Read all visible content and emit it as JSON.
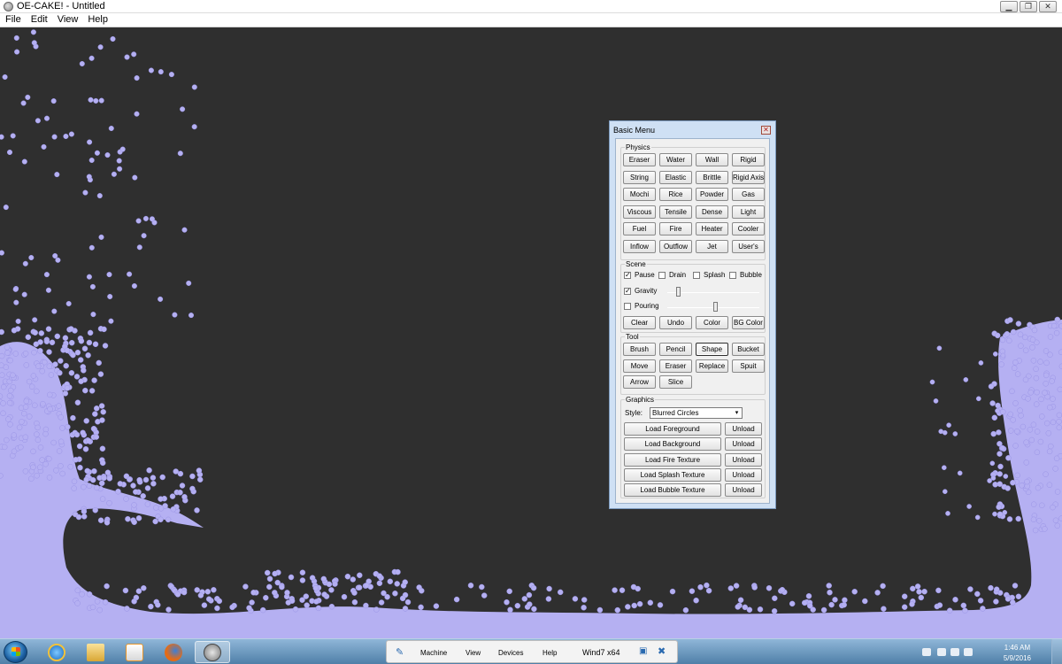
{
  "window": {
    "title": "OE-CAKE! - Untitled",
    "controls": [
      "minimize-icon",
      "restore-icon",
      "close-icon"
    ]
  },
  "menubar": {
    "items": [
      "File",
      "Edit",
      "View",
      "Help"
    ]
  },
  "panel": {
    "title": "Basic Menu",
    "physics": {
      "label": "Physics",
      "buttons": [
        "Eraser",
        "Water",
        "Wall",
        "Rigid",
        "String",
        "Elastic",
        "Brittle",
        "Rigid Axis",
        "Mochi",
        "Rice",
        "Powder",
        "Gas",
        "Viscous",
        "Tensile",
        "Dense",
        "Light",
        "Fuel",
        "Fire",
        "Heater",
        "Cooler",
        "Inflow",
        "Outflow",
        "Jet",
        "User's"
      ]
    },
    "scene": {
      "label": "Scene",
      "checks": [
        {
          "label": "Pause",
          "checked": true
        },
        {
          "label": "Drain",
          "checked": false
        },
        {
          "label": "Splash",
          "checked": false
        },
        {
          "label": "Bubble",
          "checked": false
        }
      ],
      "gravity": {
        "label": "Gravity",
        "checked": true,
        "level": 0.1
      },
      "pouring": {
        "label": "Pouring",
        "checked": false,
        "level": 0.5
      },
      "buttons": [
        "Clear",
        "Undo",
        "Color",
        "BG Color"
      ]
    },
    "tool": {
      "label": "Tool",
      "buttons": [
        "Brush",
        "Pencil",
        "Shape",
        "Bucket",
        "Move",
        "Eraser",
        "Replace",
        "Spuit",
        "Arrow",
        "Slice"
      ],
      "active": "Shape"
    },
    "graphics": {
      "label": "Graphics",
      "style_label": "Style:",
      "style_value": "Blurred Circles",
      "loaders": [
        "Load Foreground",
        "Load Background",
        "Load Fire Texture",
        "Load Splash Texture",
        "Load Bubble Texture"
      ],
      "unload_label": "Unload"
    }
  },
  "taskbar": {
    "vm": {
      "items": [
        "Machine",
        "View",
        "Devices",
        "Help"
      ],
      "name": "Wind7 x64"
    },
    "clock": {
      "time": "1:46 AM",
      "date": "5/9/2016"
    }
  },
  "colors": {
    "canvas": "#2f2f2f",
    "particle": "#b5b0f2",
    "particle_edge": "#9a94e6"
  }
}
